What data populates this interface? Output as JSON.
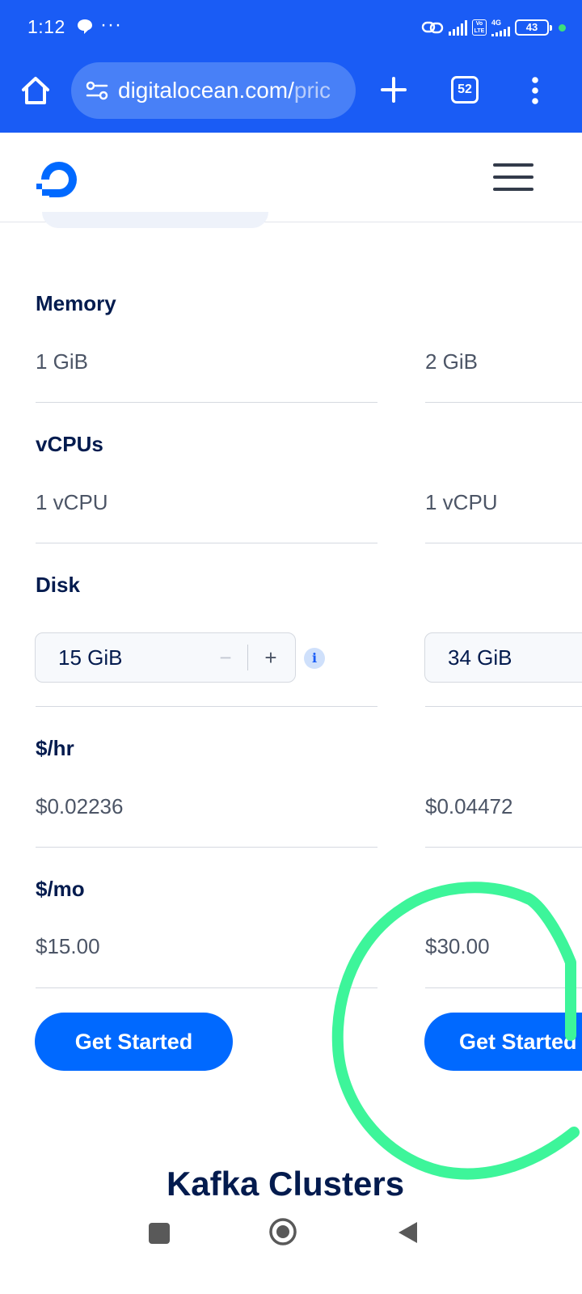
{
  "status_bar": {
    "time": "1:12",
    "dots": "···",
    "volte": "Vo LTE",
    "network": "4G",
    "battery": "43"
  },
  "browser": {
    "url_main": "digitalocean.com/",
    "url_rest": "pric",
    "tab_count": "52"
  },
  "specs": {
    "memory": {
      "label": "Memory",
      "values": [
        "1 GiB",
        "2 GiB"
      ]
    },
    "vcpus": {
      "label": "vCPUs",
      "values": [
        "1 vCPU",
        "1 vCPU"
      ]
    },
    "disk": {
      "label": "Disk",
      "values": [
        "15 GiB",
        "34 GiB"
      ],
      "minus": "−",
      "plus": "+",
      "info": "i"
    },
    "hourly": {
      "label": "$/hr",
      "values": [
        "$0.02236",
        "$0.04472"
      ]
    },
    "monthly": {
      "label": "$/mo",
      "values": [
        "$15.00",
        "$30.00"
      ]
    }
  },
  "buttons": {
    "get_started": [
      "Get Started",
      "Get Started"
    ]
  },
  "next_section": {
    "title": "Kafka Clusters"
  },
  "colors": {
    "chrome_blue": "#1a5cf5",
    "brand_blue": "#0069ff",
    "annotation_green": "#3df59a"
  },
  "icons": [
    "home-icon",
    "site-settings-icon",
    "plus-icon",
    "tab-switcher-icon",
    "more-vert-icon",
    "digitalocean-logo",
    "hamburger-menu-icon",
    "info-icon",
    "recents-icon",
    "home-nav-icon",
    "back-icon"
  ]
}
